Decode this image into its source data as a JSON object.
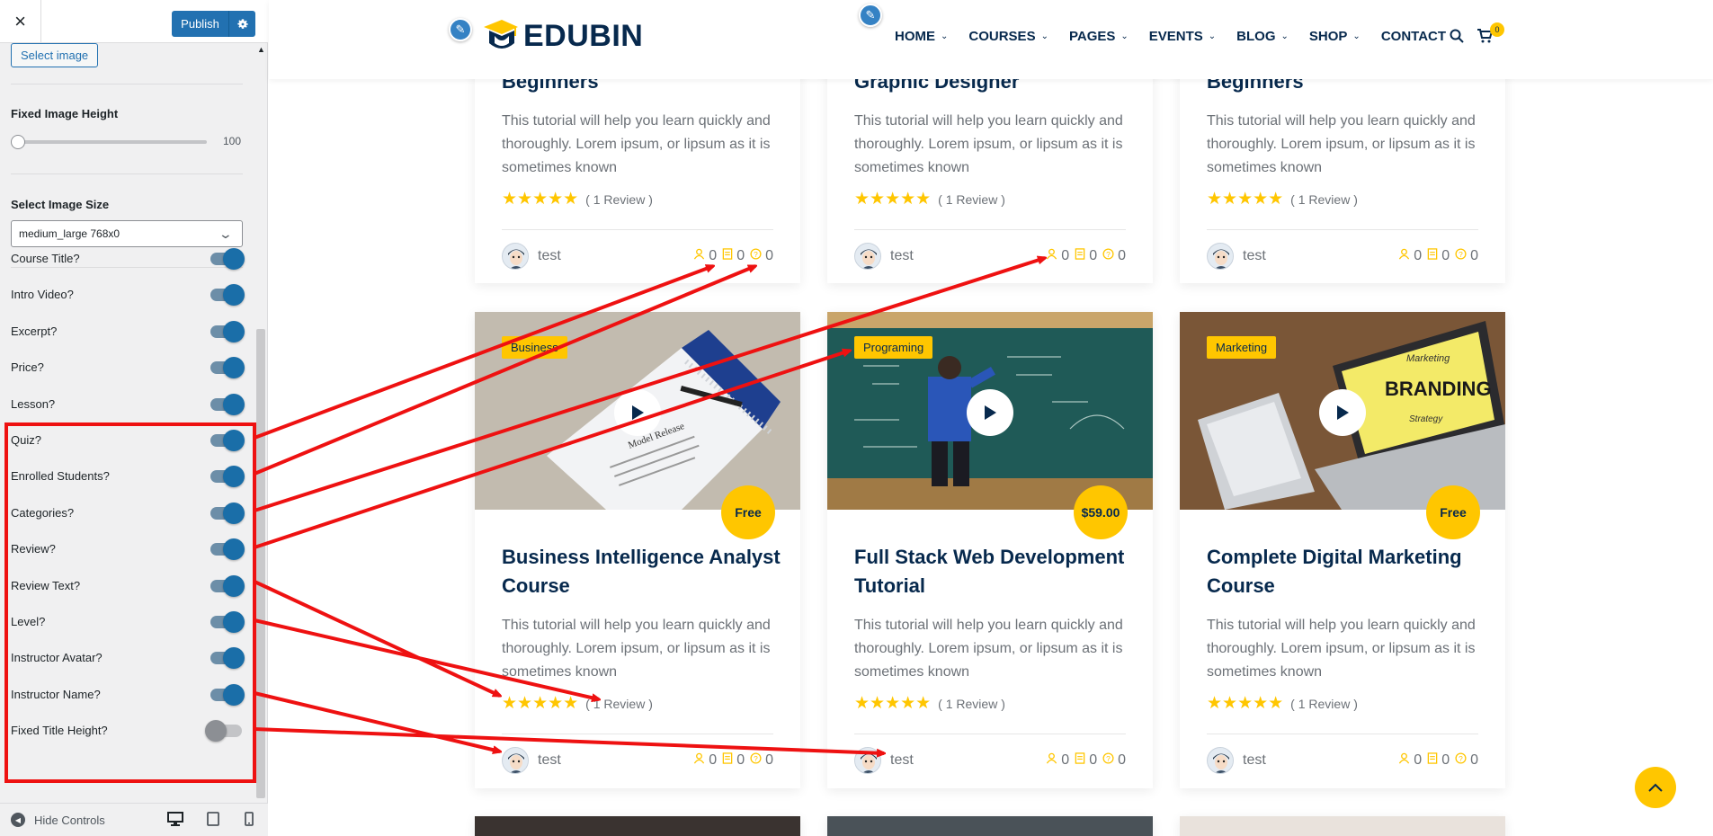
{
  "sidebar": {
    "close_label": "×",
    "publish_label": "Publish",
    "select_image_label": "Select image",
    "fixed_image_height_label": "Fixed Image Height",
    "fixed_image_height_value": "100",
    "image_size_label": "Select Image Size",
    "image_size_value": "medium_large 768x0",
    "toggles": [
      {
        "label": "Course Title?",
        "on": true
      },
      {
        "label": "Intro Video?",
        "on": true
      },
      {
        "label": "Excerpt?",
        "on": true
      },
      {
        "label": "Price?",
        "on": true
      },
      {
        "label": "Lesson?",
        "on": true
      },
      {
        "label": "Quiz?",
        "on": true
      },
      {
        "label": "Enrolled Students?",
        "on": true
      },
      {
        "label": "Categories?",
        "on": true
      },
      {
        "label": "Review?",
        "on": true
      },
      {
        "label": "Review Text?",
        "on": true
      },
      {
        "label": "Level?",
        "on": true
      },
      {
        "label": "Instructor Avatar?",
        "on": true
      },
      {
        "label": "Instructor Name?",
        "on": true
      },
      {
        "label": "Fixed Title Height?",
        "on": false
      }
    ],
    "hide_controls_label": "Hide Controls"
  },
  "header": {
    "logo_text": "EDUBIN",
    "nav": [
      {
        "label": "HOME",
        "dropdown": true
      },
      {
        "label": "COURSES",
        "dropdown": true
      },
      {
        "label": "PAGES",
        "dropdown": true
      },
      {
        "label": "EVENTS",
        "dropdown": true
      },
      {
        "label": "BLOG",
        "dropdown": true
      },
      {
        "label": "SHOP",
        "dropdown": true
      },
      {
        "label": "CONTACT",
        "dropdown": false
      }
    ],
    "cart_count": "0"
  },
  "top_cards": [
    {
      "title": "Beginners",
      "desc": "This tutorial will help you learn quickly and thoroughly. Lorem ipsum, or lipsum as it is sometimes known",
      "review_text": "( 1 Review )",
      "instructor": "test",
      "lessons": "0",
      "quizzes": "0",
      "students": "0"
    },
    {
      "title": "Graphic Designer",
      "desc": "This tutorial will help you learn quickly and thoroughly. Lorem ipsum, or lipsum as it is sometimes known",
      "review_text": "( 1 Review )",
      "instructor": "test",
      "lessons": "0",
      "quizzes": "0",
      "students": "0"
    },
    {
      "title": "Beginners",
      "desc": "This tutorial will help you learn quickly and thoroughly. Lorem ipsum, or lipsum as it is sometimes known",
      "review_text": "( 1 Review )",
      "instructor": "test",
      "lessons": "0",
      "quizzes": "0",
      "students": "0"
    }
  ],
  "cards": [
    {
      "category": "Business",
      "price": "Free",
      "title": "Business Intelligence Analyst Course",
      "desc": "This tutorial will help you learn quickly and thoroughly. Lorem ipsum, or lipsum as it is sometimes known",
      "review_text": "( 1 Review )",
      "instructor": "test",
      "lessons": "0",
      "quizzes": "0",
      "students": "0",
      "rating": 5
    },
    {
      "category": "Programing",
      "price": "$59.00",
      "title": "Full Stack Web Development Tutorial",
      "desc": "This tutorial will help you learn quickly and thoroughly. Lorem ipsum, or lipsum as it is sometimes known",
      "review_text": "( 1 Review )",
      "instructor": "test",
      "lessons": "0",
      "quizzes": "0",
      "students": "0",
      "rating": 5
    },
    {
      "category": "Marketing",
      "price": "Free",
      "title": "Complete Digital Marketing Course",
      "desc": "This tutorial will help you learn quickly and thoroughly. Lorem ipsum, or lipsum as it is sometimes known",
      "review_text": "( 1 Review )",
      "instructor": "test",
      "lessons": "0",
      "quizzes": "0",
      "students": "0",
      "rating": 5
    }
  ],
  "thumb_texts": {
    "card1_doc": "Model Release",
    "card3_screen_1": "Marketing",
    "card3_screen_2": "BRANDING",
    "card3_screen_3": "Strategy"
  },
  "colors": {
    "brand_navy": "#07294d",
    "accent_yellow": "#ffc600",
    "wp_blue": "#2271b1",
    "annotation_red": "#ee1111"
  },
  "icons": [
    "close-icon",
    "gear-icon",
    "chevron-down-icon",
    "search-icon",
    "cart-icon",
    "pencil-icon",
    "play-icon",
    "user-icon",
    "lesson-icon",
    "quiz-icon",
    "desktop-icon",
    "tablet-icon",
    "mobile-icon",
    "arrow-up-icon"
  ]
}
